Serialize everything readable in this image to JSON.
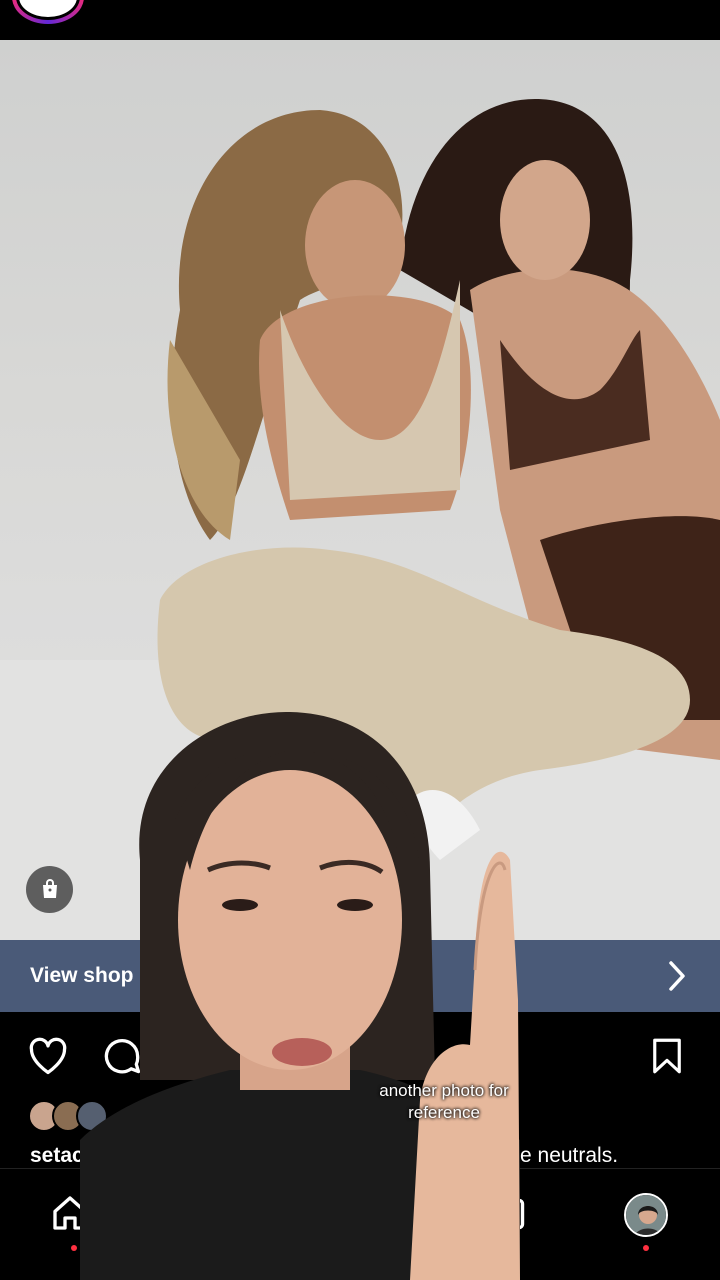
{
  "shop": {
    "label": "View shop"
  },
  "caption": {
    "username_visible": "setac",
    "text_visible": "e neutrals."
  },
  "subtitle": {
    "line1": "another photo for",
    "line2": "reference"
  },
  "icons": {
    "like": "heart-icon",
    "comment": "comment-icon",
    "save": "bookmark-icon",
    "shop": "shopping-bag-icon",
    "chevron": "chevron-right-icon",
    "home": "home-icon",
    "reels": "reels-icon",
    "profile": "profile-avatar"
  },
  "colors": {
    "shop_bar": "#4a5a78",
    "notification_dot": "#ff3040",
    "background": "#000000"
  }
}
